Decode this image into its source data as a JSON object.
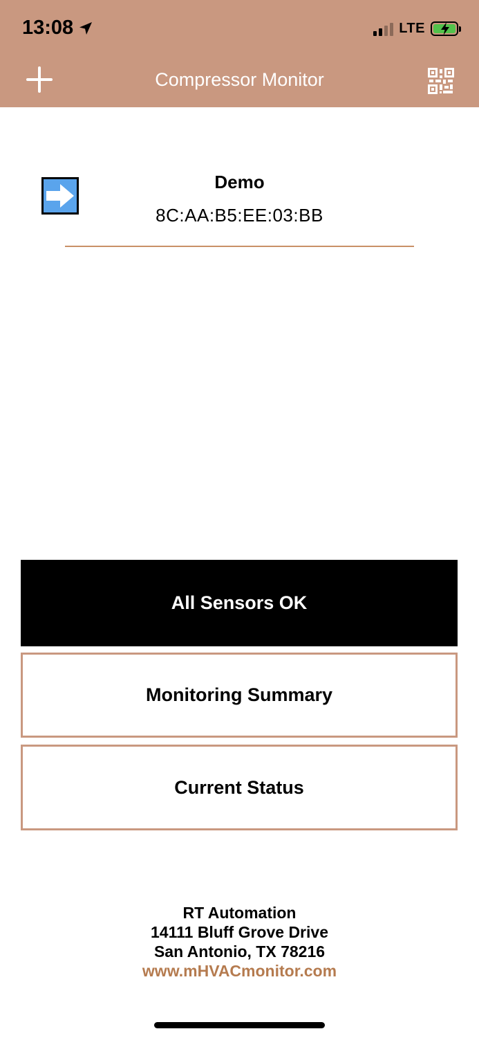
{
  "status_bar": {
    "time": "13:08",
    "network": "LTE",
    "signal_bars_active": 2,
    "signal_bars_total": 4,
    "battery_charging": true,
    "battery_color": "#52c24b"
  },
  "nav": {
    "title": "Compressor Monitor",
    "left_icon": "plus-icon",
    "right_icon": "qr-code-icon",
    "bar_color": "#c99880"
  },
  "device": {
    "name": "Demo",
    "mac": "8C:AA:B5:EE:03:BB",
    "icon": "arrow-right-icon",
    "icon_color": "#5aa4ec"
  },
  "buttons": {
    "sensors": "All Sensors OK",
    "summary": "Monitoring Summary",
    "current": "Current Status"
  },
  "footer": {
    "company": "RT Automation",
    "street": "14111 Bluff Grove Drive",
    "city": "San Antonio, TX 78216",
    "website": "www.mHVACmonitor.com",
    "link_color": "#b57b4f"
  }
}
